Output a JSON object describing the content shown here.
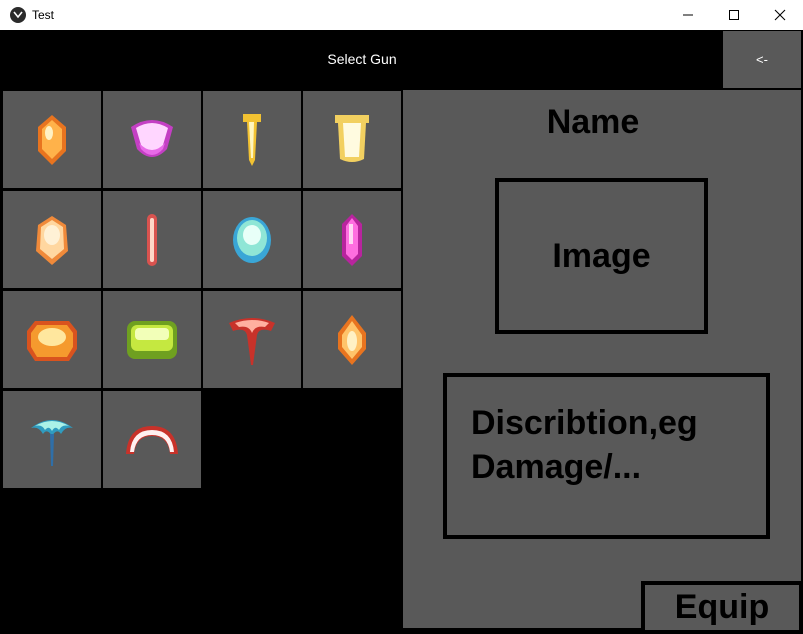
{
  "window": {
    "title": "Test"
  },
  "header": {
    "title": "Select Gun",
    "back_label": "<-"
  },
  "guns": [
    {
      "icon": "orange-gem-bullet-icon"
    },
    {
      "icon": "magenta-shield-bullet-icon"
    },
    {
      "icon": "yellow-nail-bullet-icon"
    },
    {
      "icon": "cream-cup-bullet-icon"
    },
    {
      "icon": "peach-oval-bullet-icon"
    },
    {
      "icon": "red-needle-bullet-icon"
    },
    {
      "icon": "cyan-orb-bullet-icon"
    },
    {
      "icon": "pink-capsule-bullet-icon"
    },
    {
      "icon": "fire-burst-bullet-icon"
    },
    {
      "icon": "green-block-bullet-icon"
    },
    {
      "icon": "red-horn-bullet-icon"
    },
    {
      "icon": "amber-diamond-bullet-icon"
    },
    {
      "icon": "cyan-palm-bullet-icon"
    },
    {
      "icon": "pink-crescent-bullet-icon"
    }
  ],
  "details": {
    "name": "Name",
    "image_label": "Image",
    "description_line1": "Discribtion,eg",
    "description_line2": "Damage/...",
    "equip_label": "Equip"
  }
}
